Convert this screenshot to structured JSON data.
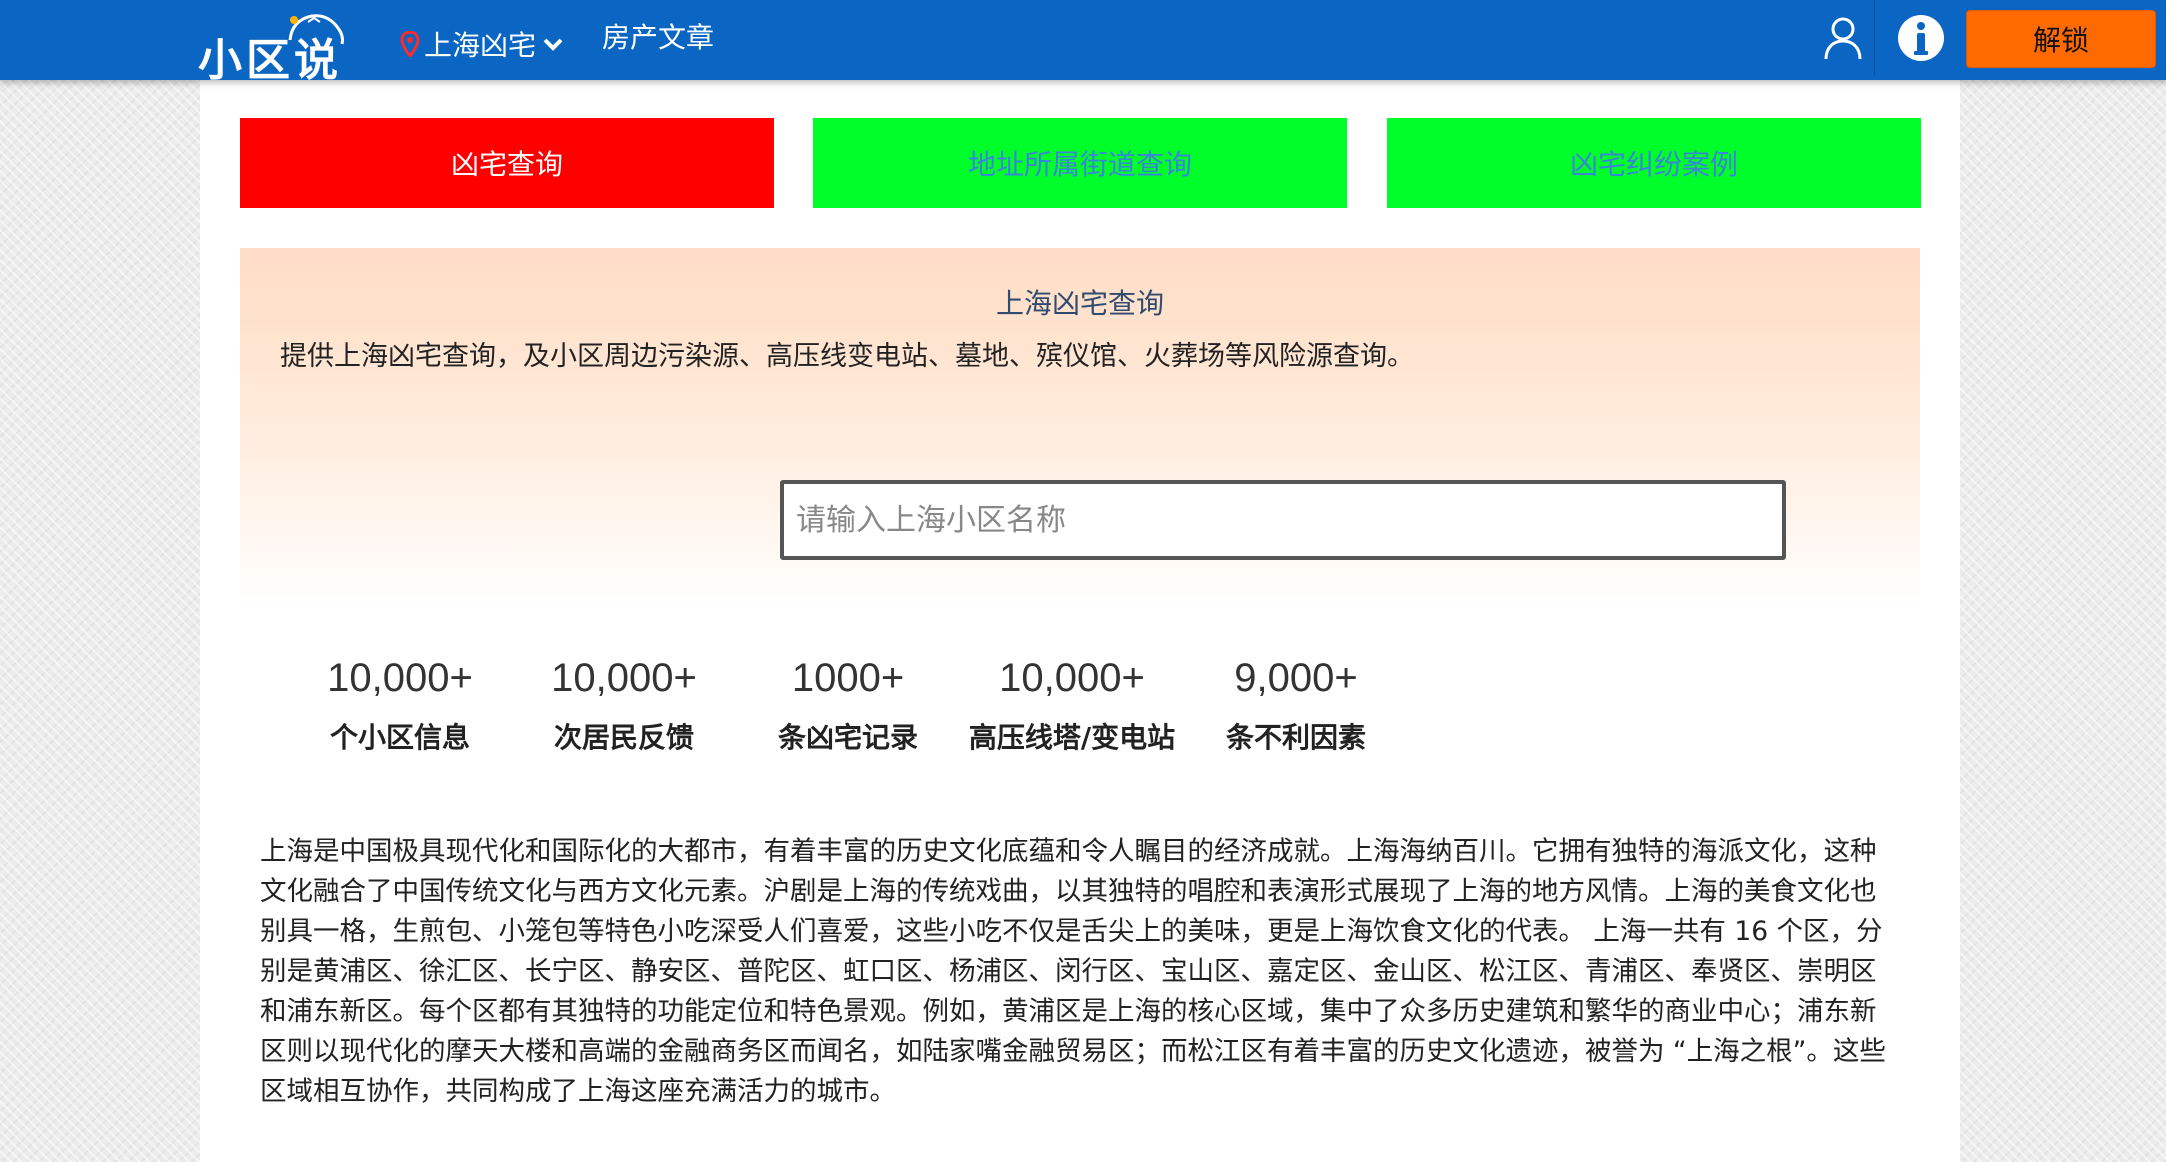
{
  "header": {
    "logo_text": "小区说",
    "city_label": "上海凶宅",
    "nav_link": "房产文章",
    "unlock_label": "解锁",
    "icons": [
      "location-pin-icon",
      "chevron-down-icon",
      "user-icon",
      "info-icon"
    ],
    "colors": {
      "bar": "#0a66c2",
      "unlock": "#ff6a00"
    }
  },
  "tabs": [
    {
      "label": "凶宅查询",
      "color": "#ff0000"
    },
    {
      "label": "地址所属街道查询",
      "color": "#00ff2a"
    },
    {
      "label": "凶宅纠纷案例",
      "color": "#00ff2a"
    }
  ],
  "hero": {
    "title": "上海凶宅查询",
    "description": "提供上海凶宅查询，及小区周边污染源、高压线变电站、墓地、殡仪馆、火葬场等风险源查询。",
    "search_placeholder": "请输入上海小区名称",
    "search_value": ""
  },
  "stats": [
    {
      "value": "10,000+",
      "label": "个小区信息"
    },
    {
      "value": "10,000+",
      "label": "次居民反馈"
    },
    {
      "value": "1000+",
      "label": "条凶宅记录"
    },
    {
      "value": "10,000+",
      "label": "高压线塔/变电站"
    },
    {
      "value": "9,000+",
      "label": "条不利因素"
    }
  ],
  "intro": "上海是中国极具现代化和国际化的大都市，有着丰富的历史文化底蕴和令人瞩目的经济成就。上海海纳百川。它拥有独特的海派文化，这种文化融合了中国传统文化与西方文化元素。沪剧是上海的传统戏曲，以其独特的唱腔和表演形式展现了上海的地方风情。上海的美食文化也别具一格，生煎包、小笼包等特色小吃深受人们喜爱，这些小吃不仅是舌尖上的美味，更是上海饮食文化的代表。 上海一共有 16 个区，分别是黄浦区、徐汇区、长宁区、静安区、普陀区、虹口区、杨浦区、闵行区、宝山区、嘉定区、金山区、松江区、青浦区、奉贤区、崇明区和浦东新区。每个区都有其独特的功能定位和特色景观。例如，黄浦区是上海的核心区域，集中了众多历史建筑和繁华的商业中心；浦东新区则以现代化的摩天大楼和高端的金融商务区而闻名，如陆家嘴金融贸易区；而松江区有着丰富的历史文化遗迹，被誉为 “上海之根”。这些区域相互协作，共同构成了上海这座充满活力的城市。"
}
